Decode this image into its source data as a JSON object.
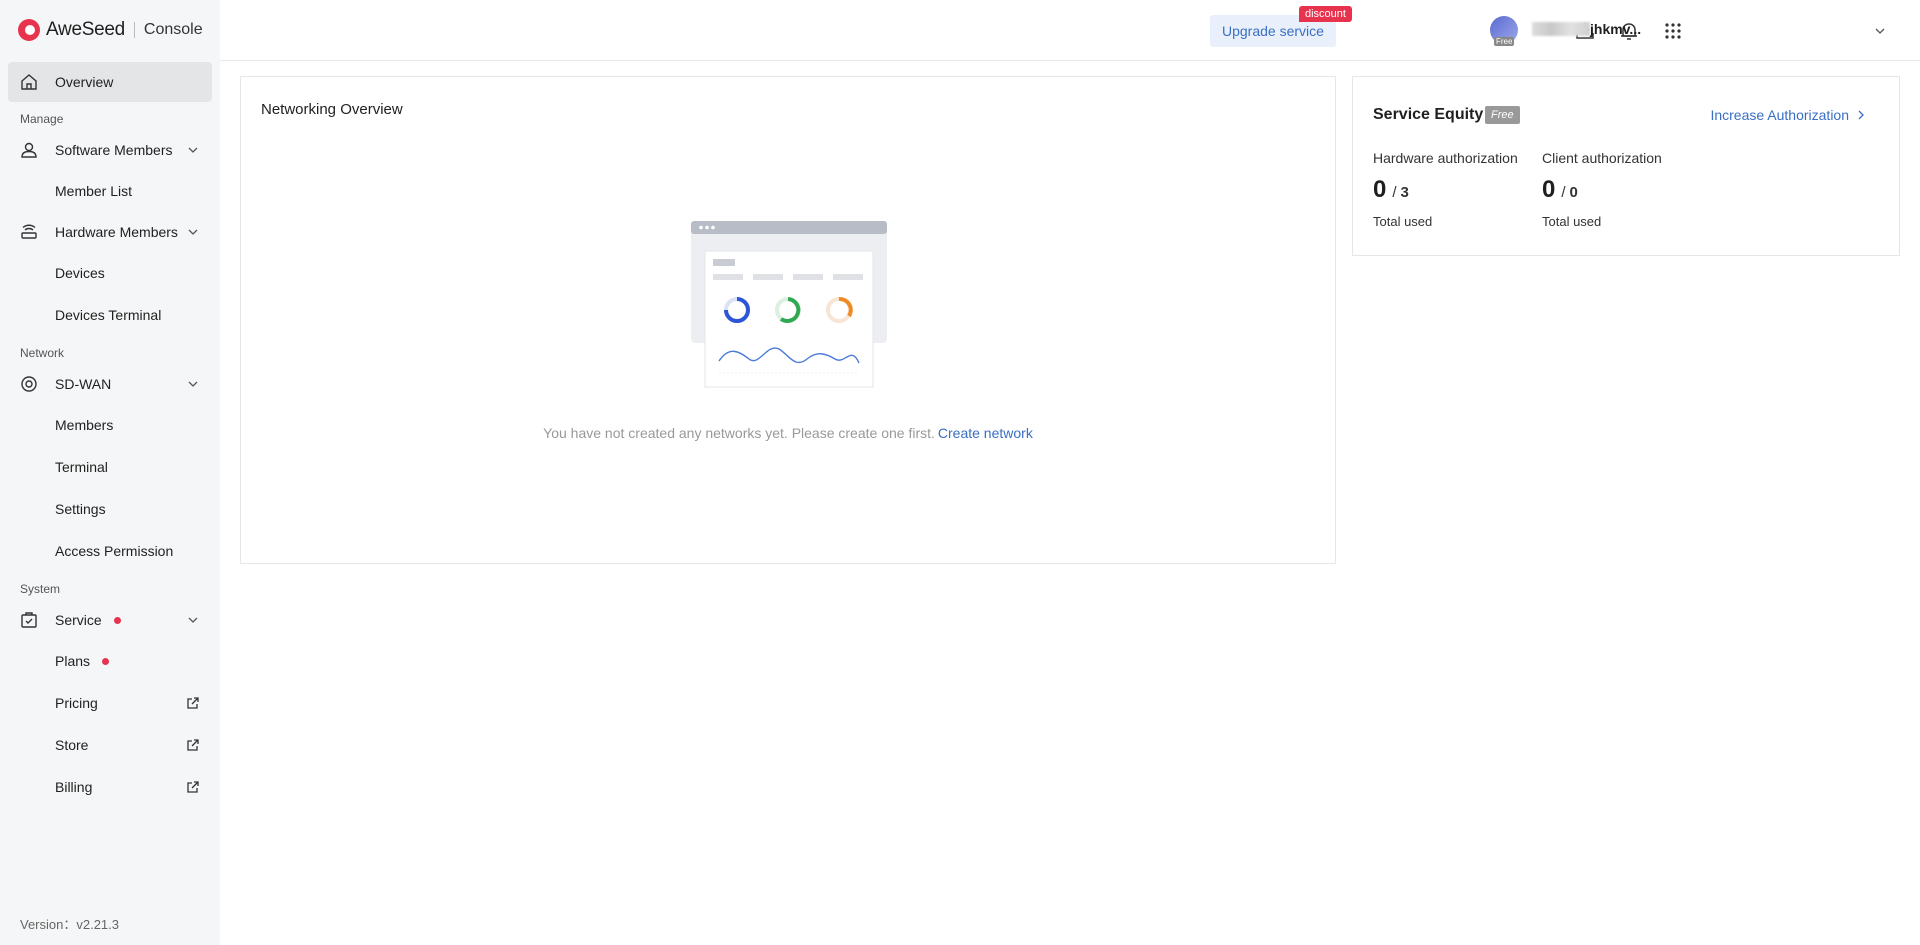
{
  "brand": {
    "name": "AweSeed",
    "console": "Console"
  },
  "sidebar": {
    "overview": "Overview",
    "sections": {
      "manage": "Manage",
      "network": "Network",
      "system": "System"
    },
    "software_members": {
      "label": "Software Members",
      "sub": {
        "member_list": "Member List"
      }
    },
    "hardware_members": {
      "label": "Hardware Members",
      "sub": {
        "devices": "Devices",
        "devices_terminal": "Devices Terminal"
      }
    },
    "sdwan": {
      "label": "SD-WAN",
      "sub": {
        "members": "Members",
        "terminal": "Terminal",
        "settings": "Settings",
        "access_permission": "Access Permission"
      }
    },
    "service": {
      "label": "Service",
      "sub": {
        "plans": "Plans",
        "pricing": "Pricing",
        "store": "Store",
        "billing": "Billing"
      }
    },
    "version": "Version：v2.21.3"
  },
  "header": {
    "upgrade_label": "Upgrade service",
    "discount_label": "discount",
    "avatar_tag": "Free",
    "username": "jhkmv..."
  },
  "networking": {
    "title": "Networking Overview",
    "empty_message": "You have not created any networks yet. Please create one first.",
    "create_link": "Create network"
  },
  "equity": {
    "title": "Service Equity",
    "badge": "Free",
    "link": "Increase Authorization",
    "hardware": {
      "label": "Hardware authorization",
      "used": "0",
      "total": "3",
      "foot": "Total used"
    },
    "client": {
      "label": "Client authorization",
      "used": "0",
      "total": "0",
      "foot": "Total used"
    }
  },
  "colors": {
    "accent": "#3a6fc4",
    "brand": "#e8334f",
    "sidebar_bg": "#f5f6f7"
  }
}
